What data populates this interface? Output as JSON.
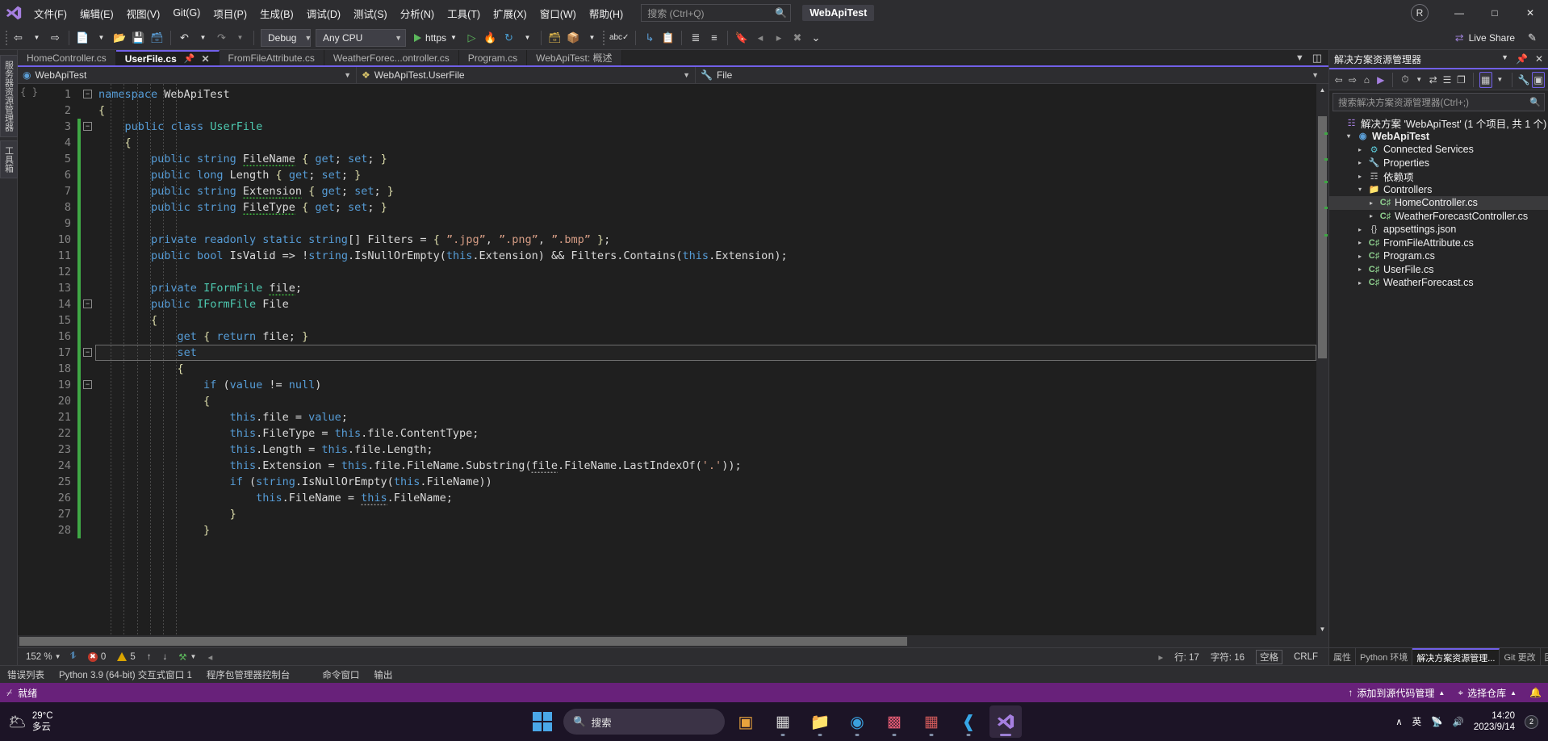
{
  "titlebar": {
    "logo_icon": "visual-studio-logo",
    "menus": [
      {
        "label": "文件(F)"
      },
      {
        "label": "编辑(E)"
      },
      {
        "label": "视图(V)"
      },
      {
        "label": "Git(G)"
      },
      {
        "label": "项目(P)"
      },
      {
        "label": "生成(B)"
      },
      {
        "label": "调试(D)"
      },
      {
        "label": "测试(S)"
      },
      {
        "label": "分析(N)"
      },
      {
        "label": "工具(T)"
      },
      {
        "label": "扩展(X)"
      },
      {
        "label": "窗口(W)"
      },
      {
        "label": "帮助(H)"
      }
    ],
    "search_placeholder": "搜索 (Ctrl+Q)",
    "search_icon": "search-icon",
    "project_chip": "WebApiTest",
    "account_initial": "R",
    "minimize_label": "—",
    "maximize_label": "□",
    "close_label": "✕"
  },
  "toolbar": {
    "nav_back_icon": "navigate-back-icon",
    "nav_fwd_icon": "navigate-forward-icon",
    "new_item_icon": "new-item-icon",
    "open_icon": "open-folder-icon",
    "save_icon": "save-icon",
    "save_all_icon": "save-all-icon",
    "undo_icon": "undo-icon",
    "redo_icon": "redo-icon",
    "config_value": "Debug",
    "platform_value": "Any CPU",
    "run_label": "https",
    "run_icon": "play-icon",
    "run_nodebug_icon": "play-outline-icon",
    "hotreload_icon": "hot-reload-icon",
    "restart_icon": "restart-icon",
    "folder_icon": "folder-explorer-icon",
    "container_icon": "container-icon",
    "spell_icon": "spellcheck-icon",
    "step_into_icon": "step-into-icon",
    "compare_icon": "compare-icon",
    "indent_icon": "indent-icon",
    "comment_icon": "comment-icon",
    "bookmark_icon": "bookmark-icon",
    "bm_prev_icon": "bookmark-prev-icon",
    "bm_next_icon": "bookmark-next-icon",
    "bm_clear_icon": "bookmark-clear-icon",
    "overflow_label": "⌄",
    "live_share_label": "Live Share",
    "live_share_icon": "live-share-icon",
    "feedback_icon": "feedback-icon"
  },
  "tabs": [
    {
      "label": "HomeController.cs",
      "active": false
    },
    {
      "label": "UserFile.cs",
      "active": true,
      "pin_icon": "pin-icon",
      "close_icon": "close-icon"
    },
    {
      "label": "FromFileAttribute.cs",
      "active": false
    },
    {
      "label": "WeatherForec...ontroller.cs",
      "active": false
    },
    {
      "label": "Program.cs",
      "active": false
    },
    {
      "label": "WebApiTest: 概述",
      "active": false
    }
  ],
  "tab_overflow_icon": "chevron-down-icon",
  "tab_split_icon": "split-window-icon",
  "navbar": {
    "project": "WebApiTest",
    "project_icon": "project-web-icon",
    "type": "WebApiTest.UserFile",
    "type_icon": "class-icon",
    "member": "File",
    "member_icon": "property-icon",
    "dropdown_icon": "chevron-down-icon"
  },
  "left_dock": {
    "tabs": [
      {
        "label": "服务器资源管理器"
      },
      {
        "label": "工具箱"
      }
    ]
  },
  "editor": {
    "structure_glyph": "{ }",
    "lines": [
      {
        "n": 1,
        "fold": "minus",
        "change": false,
        "cur": false,
        "indent": 0,
        "html": "<span class=\"kw\">namespace</span> <span class=\"id\">WebApiTest</span>"
      },
      {
        "n": 2,
        "fold": "",
        "change": false,
        "cur": false,
        "indent": 0,
        "html": "<span class=\"brc\">{</span>"
      },
      {
        "n": 3,
        "fold": "minus",
        "change": true,
        "cur": false,
        "indent": 1,
        "html": "    <span class=\"kw\">public</span> <span class=\"kw\">class</span> <span class=\"cls\">UserFile</span>"
      },
      {
        "n": 4,
        "fold": "",
        "change": true,
        "cur": false,
        "indent": 1,
        "html": "    <span class=\"brc\">{</span>"
      },
      {
        "n": 5,
        "fold": "",
        "change": true,
        "cur": false,
        "indent": 2,
        "html": "        <span class=\"kw\">public</span> <span class=\"kw\">string</span> <span class=\"id sqw\">FileName</span> <span class=\"brc\">{</span> <span class=\"kw\">get</span><span class=\"id\">;</span> <span class=\"kw\">set</span><span class=\"id\">;</span> <span class=\"brc\">}</span>"
      },
      {
        "n": 6,
        "fold": "",
        "change": true,
        "cur": false,
        "indent": 2,
        "html": "        <span class=\"kw\">public</span> <span class=\"kw\">long</span> <span class=\"id\">Length</span> <span class=\"brc\">{</span> <span class=\"kw\">get</span><span class=\"id\">;</span> <span class=\"kw\">set</span><span class=\"id\">;</span> <span class=\"brc\">}</span>"
      },
      {
        "n": 7,
        "fold": "",
        "change": true,
        "cur": false,
        "indent": 2,
        "html": "        <span class=\"kw\">public</span> <span class=\"kw\">string</span> <span class=\"id sqw\">Extension</span> <span class=\"brc\">{</span> <span class=\"kw\">get</span><span class=\"id\">;</span> <span class=\"kw\">set</span><span class=\"id\">;</span> <span class=\"brc\">}</span>"
      },
      {
        "n": 8,
        "fold": "",
        "change": true,
        "cur": false,
        "indent": 2,
        "html": "        <span class=\"kw\">public</span> <span class=\"kw\">string</span> <span class=\"id sqw\">FileType</span> <span class=\"brc\">{</span> <span class=\"kw\">get</span><span class=\"id\">;</span> <span class=\"kw\">set</span><span class=\"id\">;</span> <span class=\"brc\">}</span>"
      },
      {
        "n": 9,
        "fold": "",
        "change": true,
        "cur": false,
        "indent": 2,
        "html": ""
      },
      {
        "n": 10,
        "fold": "",
        "change": true,
        "cur": false,
        "indent": 2,
        "html": "        <span class=\"kw\">private</span> <span class=\"kw\">readonly</span> <span class=\"kw\">static</span> <span class=\"kw\">string</span><span class=\"id\">[]</span> <span class=\"id\">Filters</span> <span class=\"id\">=</span> <span class=\"brc\">{</span> <span class=\"str\">”.jpg”</span><span class=\"id\">,</span> <span class=\"str\">”.png”</span><span class=\"id\">,</span> <span class=\"str\">”.bmp”</span> <span class=\"brc\">}</span><span class=\"id\">;</span>"
      },
      {
        "n": 11,
        "fold": "",
        "change": true,
        "cur": false,
        "indent": 2,
        "html": "        <span class=\"kw\">public</span> <span class=\"kw\">bool</span> <span class=\"id\">IsValid</span> <span class=\"id\">=&gt;</span> <span class=\"id\">!</span><span class=\"kw\">string</span><span class=\"id\">.IsNullOrEmpty(</span><span class=\"kw\">this</span><span class=\"id\">.Extension)</span> <span class=\"id\">&amp;&amp;</span> <span class=\"id\">Filters.Contains(</span><span class=\"kw\">this</span><span class=\"id\">.Extension);</span>"
      },
      {
        "n": 12,
        "fold": "",
        "change": true,
        "cur": false,
        "indent": 2,
        "html": ""
      },
      {
        "n": 13,
        "fold": "",
        "change": true,
        "cur": false,
        "indent": 2,
        "html": "        <span class=\"kw\">private</span> <span class=\"typ\">IFormFile</span> <span class=\"id sqw\">file</span><span class=\"id\">;</span>"
      },
      {
        "n": 14,
        "fold": "minus",
        "change": true,
        "cur": false,
        "indent": 2,
        "html": "        <span class=\"kw\">public</span> <span class=\"typ\">IFormFile</span> <span class=\"id\">File</span>"
      },
      {
        "n": 15,
        "fold": "",
        "change": true,
        "cur": false,
        "indent": 2,
        "html": "        <span class=\"brc\">{</span>"
      },
      {
        "n": 16,
        "fold": "",
        "change": true,
        "cur": false,
        "indent": 3,
        "html": "            <span class=\"kw\">get</span> <span class=\"brc\">{</span> <span class=\"kw\">return</span> <span class=\"id\">file;</span> <span class=\"brc\">}</span>"
      },
      {
        "n": 17,
        "fold": "minus",
        "change": true,
        "cur": true,
        "indent": 3,
        "html": "            <span class=\"kw\">set</span>"
      },
      {
        "n": 18,
        "fold": "",
        "change": true,
        "cur": false,
        "indent": 3,
        "html": "            <span class=\"brc\">{</span>"
      },
      {
        "n": 19,
        "fold": "minus",
        "change": true,
        "cur": false,
        "indent": 4,
        "html": "                <span class=\"kw\">if</span> <span class=\"id\">(</span><span class=\"kw\">value</span> <span class=\"id\">!=</span> <span class=\"kw\">null</span><span class=\"id\">)</span>"
      },
      {
        "n": 20,
        "fold": "",
        "change": true,
        "cur": false,
        "indent": 4,
        "html": "                <span class=\"brc\">{</span>"
      },
      {
        "n": 21,
        "fold": "",
        "change": true,
        "cur": false,
        "indent": 5,
        "html": "                    <span class=\"kw\">this</span><span class=\"id\">.file = </span><span class=\"kw\">value</span><span class=\"id\">;</span>"
      },
      {
        "n": 22,
        "fold": "",
        "change": true,
        "cur": false,
        "indent": 5,
        "html": "                    <span class=\"kw\">this</span><span class=\"id\">.FileType = </span><span class=\"kw\">this</span><span class=\"id\">.file.ContentType;</span>"
      },
      {
        "n": 23,
        "fold": "",
        "change": true,
        "cur": false,
        "indent": 5,
        "html": "                    <span class=\"kw\">this</span><span class=\"id\">.Length = </span><span class=\"kw\">this</span><span class=\"id\">.file.Length;</span>"
      },
      {
        "n": 24,
        "fold": "",
        "change": true,
        "cur": false,
        "indent": 5,
        "html": "                    <span class=\"kw\">this</span><span class=\"id\">.Extension = </span><span class=\"kw\">this</span><span class=\"id\">.file.FileName.Substring(</span><span class=\"id sqw grey\">file</span><span class=\"id\">.FileName.LastIndexOf(</span><span class=\"str\">'.'</span><span class=\"id\">));</span>"
      },
      {
        "n": 25,
        "fold": "",
        "change": true,
        "cur": false,
        "indent": 5,
        "html": "                    <span class=\"kw\">if</span> <span class=\"id\">(</span><span class=\"kw\">string</span><span class=\"id\">.IsNullOrEmpty(</span><span class=\"kw\">this</span><span class=\"id\">.FileName))</span>"
      },
      {
        "n": 26,
        "fold": "",
        "change": true,
        "cur": false,
        "indent": 6,
        "html": "                        <span class=\"kw\">this</span><span class=\"id\">.FileName = </span><span class=\"kw sqw grey\">this</span><span class=\"id\">.FileName;</span>"
      },
      {
        "n": 27,
        "fold": "",
        "change": true,
        "cur": false,
        "indent": 5,
        "html": "                    <span class=\"brc\">}</span>"
      },
      {
        "n": 28,
        "fold": "",
        "change": true,
        "cur": false,
        "indent": 4,
        "html": "                <span class=\"brc\">}</span>"
      }
    ]
  },
  "editor_status": {
    "zoom": "152 %",
    "errors": "0",
    "warnings": "5",
    "up_icon": "arrow-up-icon",
    "down_icon": "arrow-down-icon",
    "line_label": "行: 17",
    "col_label": "字符: 16",
    "space_label": "空格",
    "eol_label": "CRLF",
    "prev_icon": "prev-icon"
  },
  "solution_explorer": {
    "title": "解决方案资源管理器",
    "dropdown_icon": "chevron-down-icon",
    "pin_icon": "pin-icon",
    "close_icon": "close-icon",
    "toolbar_icons": [
      "back-icon",
      "forward-icon",
      "home-icon",
      "pending-changes-icon",
      "history-icon",
      "sync-icon",
      "collapse-all-icon",
      "copy-icon",
      "show-all-files-icon",
      "properties-wrench-icon",
      "preview-selected-icon"
    ],
    "search_placeholder": "搜索解决方案资源管理器(Ctrl+;)",
    "search_icon": "search-icon",
    "tree": [
      {
        "label": "解决方案 'WebApiTest' (1 个项目, 共 1 个)",
        "icon": "solution-icon",
        "indent": 0,
        "expander": "",
        "bold": false,
        "selected": false
      },
      {
        "label": "WebApiTest",
        "icon": "project-web-icon",
        "indent": 1,
        "expander": "▲",
        "bold": true,
        "selected": false
      },
      {
        "label": "Connected Services",
        "icon": "connected-services-icon",
        "indent": 2,
        "expander": "▷",
        "bold": false,
        "selected": false
      },
      {
        "label": "Properties",
        "icon": "properties-icon",
        "indent": 2,
        "expander": "▷",
        "bold": false,
        "selected": false
      },
      {
        "label": "依赖项",
        "icon": "dependencies-icon",
        "indent": 2,
        "expander": "▷",
        "bold": false,
        "selected": false
      },
      {
        "label": "Controllers",
        "icon": "folder-icon",
        "indent": 2,
        "expander": "▲",
        "bold": false,
        "selected": false
      },
      {
        "label": "HomeController.cs",
        "icon": "csharp-icon",
        "indent": 3,
        "expander": "▷",
        "bold": false,
        "selected": true
      },
      {
        "label": "WeatherForecastController.cs",
        "icon": "csharp-icon",
        "indent": 3,
        "expander": "▷",
        "bold": false,
        "selected": false
      },
      {
        "label": "appsettings.json",
        "icon": "json-icon",
        "indent": 2,
        "expander": "▷",
        "bold": false,
        "selected": false
      },
      {
        "label": "FromFileAttribute.cs",
        "icon": "csharp-icon",
        "indent": 2,
        "expander": "▷",
        "bold": false,
        "selected": false
      },
      {
        "label": "Program.cs",
        "icon": "csharp-icon",
        "indent": 2,
        "expander": "▷",
        "bold": false,
        "selected": false
      },
      {
        "label": "UserFile.cs",
        "icon": "csharp-icon",
        "indent": 2,
        "expander": "▷",
        "bold": false,
        "selected": false
      },
      {
        "label": "WeatherForecast.cs",
        "icon": "csharp-icon",
        "indent": 2,
        "expander": "▷",
        "bold": false,
        "selected": false
      }
    ],
    "panel_tabs": [
      {
        "label": "属性",
        "active": false
      },
      {
        "label": "Python 环境",
        "active": false
      },
      {
        "label": "解决方案资源管理...",
        "active": true
      },
      {
        "label": "Git 更改",
        "active": false
      },
      {
        "label": "团队...",
        "active": false
      }
    ]
  },
  "bottom_dock": {
    "tabs": [
      {
        "label": "错误列表",
        "active": false
      },
      {
        "label": "Python 3.9 (64-bit) 交互式窗口 1",
        "active": false
      },
      {
        "label": "程序包管理器控制台",
        "active": false
      },
      {
        "label": "命令窗口",
        "active": false
      },
      {
        "label": "输出",
        "active": false
      }
    ]
  },
  "vs_status": {
    "ready_label": "就绪",
    "ready_icon": "ready-icon",
    "source_control_label": "添加到源代码管理",
    "source_control_icon": "arrow-up-icon",
    "repo_label": "选择仓库",
    "repo_icon": "repo-icon",
    "notification_icon": "bell-icon",
    "caret_icon": "caret-up-icon"
  },
  "taskbar": {
    "weather_temp": "29°C",
    "weather_desc": "多云",
    "weather_icon": "cloudy-icon",
    "start_icon": "windows-start-icon",
    "search_placeholder": "搜索",
    "search_icon": "search-icon",
    "apps": [
      {
        "name": "copilot-icon",
        "glyph": "◧",
        "color": "#e8a33d",
        "running": false,
        "active": false
      },
      {
        "name": "task-view-icon",
        "glyph": "▥",
        "color": "#d6d6d6",
        "running": false,
        "active": false
      },
      {
        "name": "file-explorer-icon",
        "glyph": "▤",
        "color": "#f0c14b",
        "running": true,
        "active": false
      },
      {
        "name": "edge-icon",
        "glyph": "◉",
        "color": "#3aa0dd",
        "running": true,
        "active": false
      },
      {
        "name": "store-icon",
        "glyph": "▣",
        "color": "#e85d75",
        "running": true,
        "active": false
      },
      {
        "name": "phone-link-icon",
        "glyph": "▩",
        "color": "#d05a5a",
        "running": true,
        "active": false
      },
      {
        "name": "vscode-icon",
        "glyph": "◤",
        "color": "#37a6e6",
        "running": true,
        "active": false
      },
      {
        "name": "visual-studio-icon",
        "glyph": "N",
        "color": "#9b7fd4",
        "running": true,
        "active": true
      }
    ],
    "tray_caret": "∧",
    "ime_label": "英",
    "network_icon": "network-icon",
    "volume_icon": "volume-icon",
    "time": "14:20",
    "date": "2023/9/14",
    "notif_count": "2"
  }
}
